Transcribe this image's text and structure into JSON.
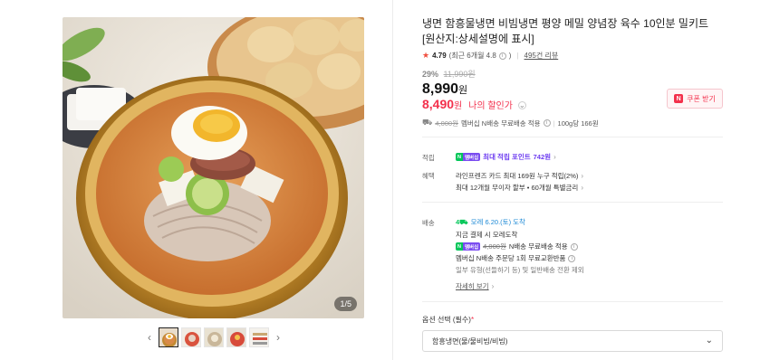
{
  "gallery": {
    "counter": "1/5",
    "prev_icon": "‹",
    "next_icon": "›"
  },
  "product": {
    "title": "냉면 함흥물냉면 비빔냉면 평양 메밀 양념장 육수 10인분 밀키트 [원산지:상세설명에 표시]",
    "rating": {
      "score": "4.79",
      "recent": "(최근 6개월 4.8",
      "reviews": "495건 리뷰"
    },
    "discount_pct": "29%",
    "original_price": "11,990원",
    "price": "8,990",
    "price_unit": "원",
    "my_price": "8,490",
    "my_price_unit": "원",
    "my_price_label": "나의 할인가"
  },
  "coupon": {
    "badge": "N",
    "label": "쿠폰 받기"
  },
  "shipping_line": {
    "strike": "4,000원",
    "text": "멤버십 N배송 무료배송 적용",
    "unit_price": "100g당 166원"
  },
  "points": {
    "label": "적립",
    "badge_n": "N",
    "badge_m": "멤버십",
    "text": "최대 적립 포인트",
    "amount": "742원"
  },
  "benefits": {
    "label": "혜택",
    "line1": "라인프렌즈 카드 최대 169원 누구 적립(2%)",
    "line2": "최대 12개월 무이자 할부 • 60개월 특별금리"
  },
  "delivery": {
    "label": "배송",
    "badge": "4",
    "arrival": "모레 6.20.(토) 도착",
    "line2": "지금 결제 시 모레도착",
    "line3_strike": "4,000원",
    "line3": "N배송 무료배송 적용",
    "line4": "멤버십 N배송 주문당 1회 무료교환반품",
    "line5": "일부 유형(선들하기 등) 및 일반배송 전환 제외",
    "details": "자세히 보기"
  },
  "options": {
    "label": "옵션 선택 (필수)",
    "required_mark": "*",
    "selected": "함흥냉면(물/물비빔/비빔)"
  },
  "colors": {
    "accent": "#f3304c",
    "naver_green": "#03c75a",
    "membership_purple": "#6d3cf0"
  }
}
